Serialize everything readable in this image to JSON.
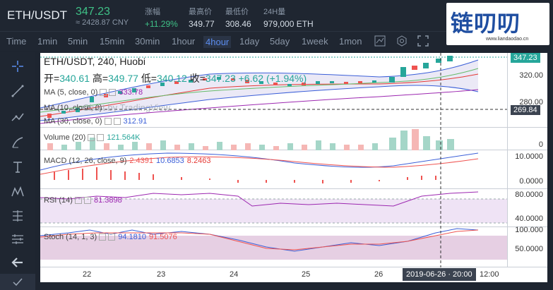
{
  "header": {
    "pair": "ETH/USDT",
    "price": "347.23",
    "price_cny": "≈ 2428.87 CNY",
    "change_label": "涨幅",
    "change_value": "+11.29%",
    "high_label": "最高价",
    "high_value": "349.77",
    "low_label": "最低价",
    "low_value": "308.46",
    "volume_label": "24H量",
    "volume_value": "979,000 ETH"
  },
  "logo": {
    "text": "链叨叨",
    "url": "www.liandaodao.cn"
  },
  "toolbar": {
    "timeframes": [
      "Time",
      "1min",
      "5min",
      "15min",
      "30min",
      "1hour",
      "4hour",
      "1day",
      "5day",
      "1week",
      "1mon"
    ],
    "active": "4hour"
  },
  "chart": {
    "title": "ETH/USDT, 240, Huobi",
    "ohlc_open_label": "开=",
    "ohlc_open": "340.61",
    "ohlc_high_label": "高=",
    "ohlc_high": "349.77",
    "ohlc_low_label": "低=",
    "ohlc_low": "340.12",
    "ohlc_close_label": "收=",
    "ohlc_close": "347.23",
    "ohlc_change": "+6.62 (+1.94%)",
    "ma5": "MA (5, close, 0)",
    "ma5_value": "333.78",
    "ma10": "MA (10, close, 0)",
    "ma30": "MA (30, close, 0)",
    "ma30_value": "312.91",
    "watermark": "Chart by TradingView",
    "volume_legend": "Volume (20)",
    "volume_value": "121.564K",
    "macd_legend": "MACD (12, 26, close, 9)",
    "macd_v1": "2.4391",
    "macd_v2": "10.6853",
    "macd_v3": "8.2463",
    "rsi_legend": "RSI (14)",
    "rsi_value": "81.3898",
    "stoch_legend": "Stoch (14, 1, 3)",
    "stoch_v1": "94.1810",
    "stoch_v2": "91.5076",
    "price_ticks": [
      "320.00",
      "280.00"
    ],
    "price_tag": "347.23",
    "crosshair_tag": "269.84",
    "volume_ticks": [
      "0"
    ],
    "macd_ticks": [
      "10.0000",
      "0.0000"
    ],
    "rsi_ticks": [
      "80.0000",
      "40.0000"
    ],
    "stoch_ticks": [
      "100.000",
      "50.0000"
    ],
    "x_labels": [
      "22",
      "23",
      "24",
      "25",
      "26",
      "12:00"
    ],
    "date_box": "2019-06-26 · 20:00"
  },
  "colors": {
    "up": "#26a69a",
    "down": "#ef5350",
    "accent": "#5b8def",
    "bg": "#1e2530"
  }
}
